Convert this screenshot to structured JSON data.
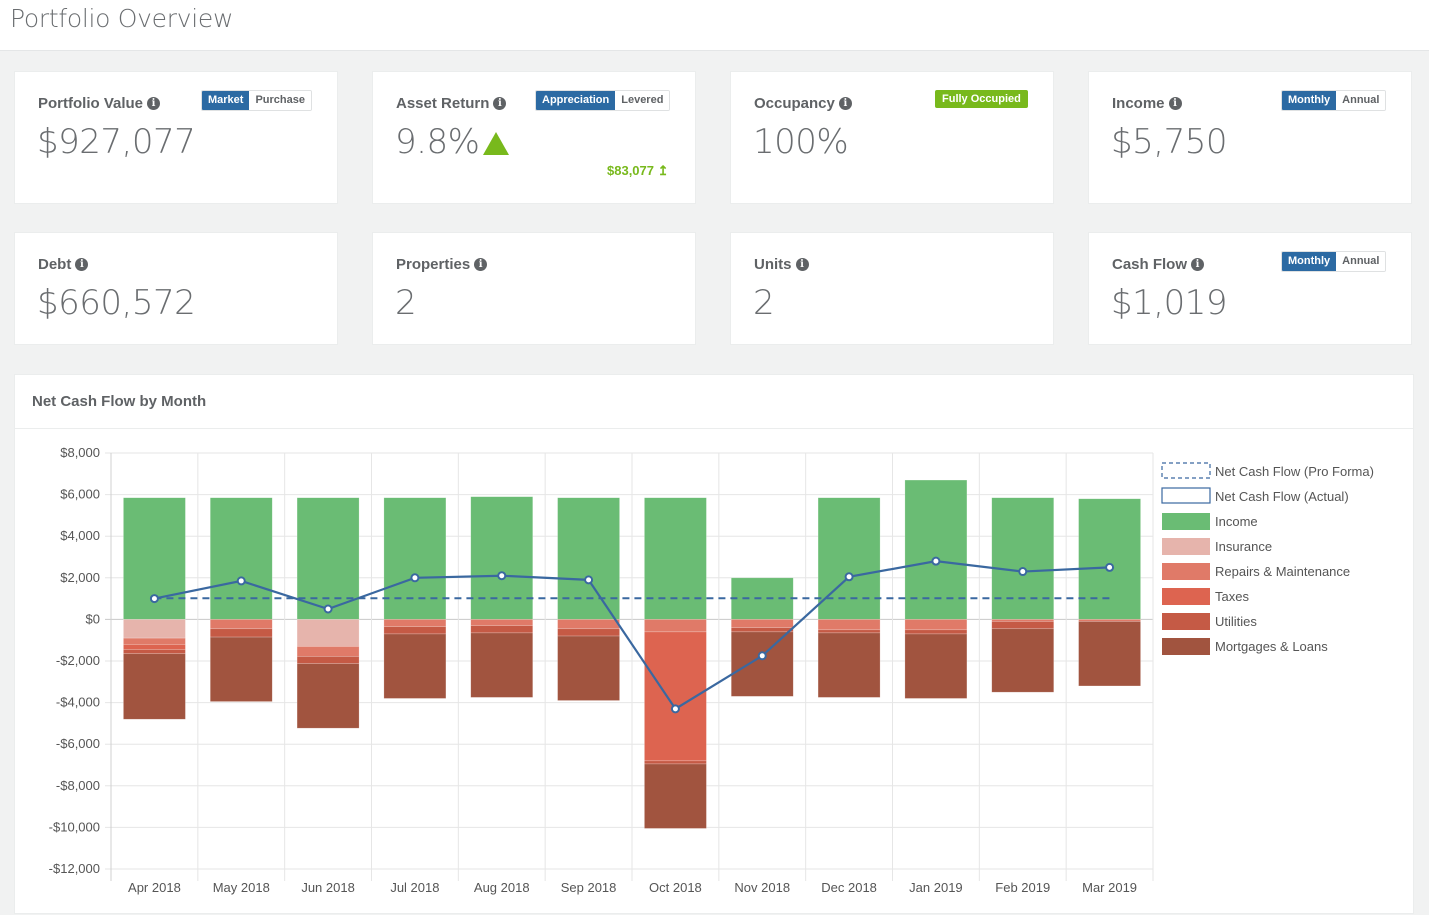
{
  "page": {
    "title": "Portfolio Overview"
  },
  "cards": {
    "portfolio_value": {
      "label": "Portfolio Value",
      "value": "$927,077",
      "toggle": [
        "Market",
        "Purchase"
      ],
      "active": 0
    },
    "asset_return": {
      "label": "Asset Return",
      "value": "9.8%",
      "toggle": [
        "Appreciation",
        "Levered"
      ],
      "active": 0,
      "gain": "$83,077 ↥",
      "trend": "up"
    },
    "occupancy": {
      "label": "Occupancy",
      "value": "100%",
      "badge": "Fully Occupied"
    },
    "income": {
      "label": "Income",
      "value": "$5,750",
      "toggle": [
        "Monthly",
        "Annual"
      ],
      "active": 0
    },
    "debt": {
      "label": "Debt",
      "value": "$660,572"
    },
    "properties": {
      "label": "Properties",
      "value": "2"
    },
    "units": {
      "label": "Units",
      "value": "2"
    },
    "cash_flow": {
      "label": "Cash Flow",
      "value": "$1,019",
      "toggle": [
        "Monthly",
        "Annual"
      ],
      "active": 0
    }
  },
  "colors": {
    "accent": "#2c6aa3",
    "positive": "#78b91c",
    "income": "#6abc74",
    "insurance": "#e6b4ac",
    "repairs": "#e07a68",
    "taxes": "#dd6450",
    "utilities": "#c55a45",
    "mortgages": "#a1543f",
    "line": "#3a68a0"
  },
  "chart_data": {
    "type": "bar",
    "title": "Net Cash Flow by Month",
    "xlabel": "",
    "ylabel": "",
    "ylim": [
      -12000,
      8000
    ],
    "yticks": [
      8000,
      6000,
      4000,
      2000,
      0,
      -2000,
      -4000,
      -6000,
      -8000,
      -10000,
      -12000
    ],
    "ytick_labels": [
      "$8,000",
      "$6,000",
      "$4,000",
      "$2,000",
      "$0",
      "-$2,000",
      "-$4,000",
      "-$6,000",
      "-$8,000",
      "-$10,000",
      "-$12,000"
    ],
    "grid": true,
    "legend_position": "right",
    "categories": [
      "Apr 2018",
      "May 2018",
      "Jun 2018",
      "Jul 2018",
      "Aug 2018",
      "Sep 2018",
      "Oct 2018",
      "Nov 2018",
      "Dec 2018",
      "Jan 2019",
      "Feb 2019",
      "Mar 2019"
    ],
    "series": [
      {
        "name": "Income",
        "kind": "bar",
        "color_key": "income",
        "values": [
          5850,
          5850,
          5850,
          5850,
          5900,
          5850,
          5850,
          2000,
          5850,
          6700,
          5850,
          5800
        ]
      },
      {
        "name": "Insurance",
        "kind": "bar",
        "color_key": "insurance",
        "values": [
          -900,
          0,
          -1300,
          0,
          0,
          0,
          0,
          0,
          0,
          0,
          0,
          0
        ]
      },
      {
        "name": "Repairs & Maintenance",
        "kind": "bar",
        "color_key": "repairs",
        "values": [
          -300,
          -450,
          -480,
          -350,
          -300,
          -450,
          -600,
          -400,
          -500,
          -500,
          -100,
          -100
        ]
      },
      {
        "name": "Taxes",
        "kind": "bar",
        "color_key": "taxes",
        "values": [
          -250,
          0,
          0,
          0,
          0,
          0,
          -6200,
          0,
          0,
          0,
          0,
          0
        ]
      },
      {
        "name": "Utilities",
        "kind": "bar",
        "color_key": "utilities",
        "values": [
          -200,
          -400,
          -350,
          -350,
          -350,
          -350,
          -150,
          -200,
          -150,
          -200,
          -350,
          0
        ]
      },
      {
        "name": "Mortgages & Loans",
        "kind": "bar",
        "color_key": "mortgages",
        "values": [
          -3150,
          -3100,
          -3100,
          -3100,
          -3100,
          -3100,
          -3100,
          -3100,
          -3100,
          -3100,
          -3050,
          -3100
        ]
      },
      {
        "name": "Net Cash Flow (Actual)",
        "kind": "line",
        "values": [
          1000,
          1850,
          500,
          2000,
          2100,
          1900,
          -4300,
          -1750,
          2050,
          2800,
          2300,
          2500
        ]
      },
      {
        "name": "Net Cash Flow (Pro Forma)",
        "kind": "dashed-line",
        "values": [
          1019,
          1019,
          1019,
          1019,
          1019,
          1019,
          1019,
          1019,
          1019,
          1019,
          1019,
          1019
        ]
      }
    ],
    "legend": [
      {
        "label": "Net Cash Flow (Pro Forma)",
        "style": "dashed"
      },
      {
        "label": "Net Cash Flow (Actual)",
        "style": "outline"
      },
      {
        "label": "Income",
        "color_key": "income"
      },
      {
        "label": "Insurance",
        "color_key": "insurance"
      },
      {
        "label": "Repairs & Maintenance",
        "color_key": "repairs"
      },
      {
        "label": "Taxes",
        "color_key": "taxes"
      },
      {
        "label": "Utilities",
        "color_key": "utilities"
      },
      {
        "label": "Mortgages & Loans",
        "color_key": "mortgages"
      }
    ]
  }
}
